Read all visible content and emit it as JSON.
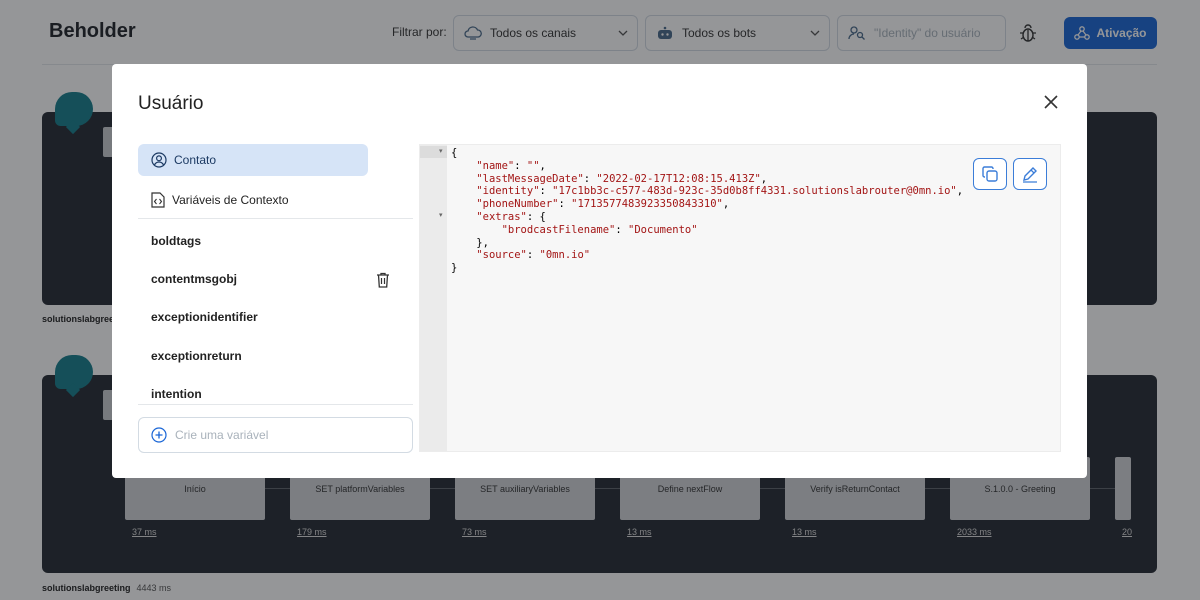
{
  "app": {
    "title": "Beholder"
  },
  "filters": {
    "label": "Filtrar por:",
    "channels": "Todos os canais",
    "bots": "Todos os bots",
    "identity_placeholder": "\"Identity\" do usuário"
  },
  "activation_button": "Ativação",
  "background": {
    "flow1": {
      "name": "solutionslabgreet"
    },
    "flow2": {
      "name": "solutionslabgreeting",
      "duration": "4443 ms"
    },
    "steps": [
      {
        "label": "Início",
        "time": "37 ms"
      },
      {
        "label": "SET platformVariables",
        "time": "179 ms"
      },
      {
        "label": "SET auxiliaryVariables",
        "time": "73 ms"
      },
      {
        "label": "Define nextFlow",
        "time": "13 ms"
      },
      {
        "label": "Verify isReturnContact",
        "time": "13 ms"
      },
      {
        "label": "S.1.0.0 - Greeting",
        "time": "2033 ms"
      },
      {
        "label": "",
        "time": "20"
      }
    ]
  },
  "modal": {
    "title": "Usuário",
    "tabs": {
      "contact": "Contato",
      "context": "Variáveis de Contexto"
    },
    "variables": [
      "boldtags",
      "contentmsgobj",
      "exceptionidentifier",
      "exceptionreturn",
      "intention"
    ],
    "new_variable_placeholder": "Crie uma variável",
    "json": {
      "open": "{",
      "name_key": "\"name\"",
      "name_val": "\"\"",
      "lmd_key": "\"lastMessageDate\"",
      "lmd_val": "\"2022-02-17T12:08:15.413Z\"",
      "id_key": "\"identity\"",
      "id_val": "\"17c1bb3c-c577-483d-923c-35d0b8ff4331.solutionslabrouter@0mn.io\"",
      "phone_key": "\"phoneNumber\"",
      "phone_val": "\"1713577483923350843310\"",
      "extras_key": "\"extras\"",
      "bf_key": "\"brodcastFilename\"",
      "bf_val": "\"Documento\"",
      "source_key": "\"source\"",
      "source_val": "\"0mn.io\"",
      "close": "}"
    }
  },
  "colors": {
    "accent": "#1a66d6",
    "card": "#262b33",
    "teal": "#167f8c",
    "json_string": "#a31515"
  }
}
